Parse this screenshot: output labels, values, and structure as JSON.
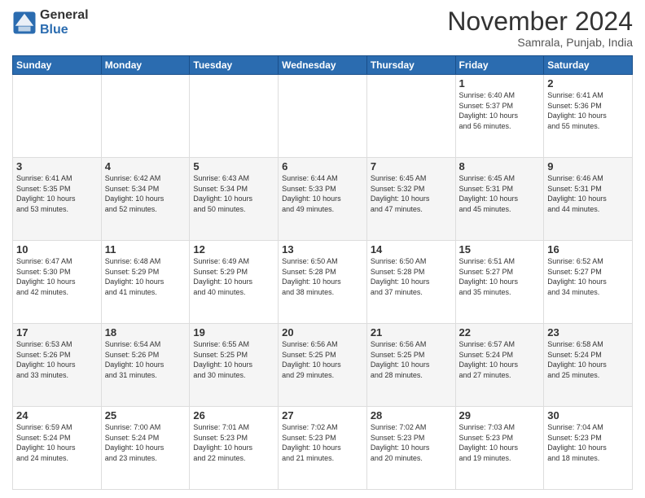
{
  "logo": {
    "general": "General",
    "blue": "Blue"
  },
  "title": "November 2024",
  "location": "Samrala, Punjab, India",
  "headers": [
    "Sunday",
    "Monday",
    "Tuesday",
    "Wednesday",
    "Thursday",
    "Friday",
    "Saturday"
  ],
  "weeks": [
    [
      {
        "day": "",
        "info": ""
      },
      {
        "day": "",
        "info": ""
      },
      {
        "day": "",
        "info": ""
      },
      {
        "day": "",
        "info": ""
      },
      {
        "day": "",
        "info": ""
      },
      {
        "day": "1",
        "info": "Sunrise: 6:40 AM\nSunset: 5:37 PM\nDaylight: 10 hours\nand 56 minutes."
      },
      {
        "day": "2",
        "info": "Sunrise: 6:41 AM\nSunset: 5:36 PM\nDaylight: 10 hours\nand 55 minutes."
      }
    ],
    [
      {
        "day": "3",
        "info": "Sunrise: 6:41 AM\nSunset: 5:35 PM\nDaylight: 10 hours\nand 53 minutes."
      },
      {
        "day": "4",
        "info": "Sunrise: 6:42 AM\nSunset: 5:34 PM\nDaylight: 10 hours\nand 52 minutes."
      },
      {
        "day": "5",
        "info": "Sunrise: 6:43 AM\nSunset: 5:34 PM\nDaylight: 10 hours\nand 50 minutes."
      },
      {
        "day": "6",
        "info": "Sunrise: 6:44 AM\nSunset: 5:33 PM\nDaylight: 10 hours\nand 49 minutes."
      },
      {
        "day": "7",
        "info": "Sunrise: 6:45 AM\nSunset: 5:32 PM\nDaylight: 10 hours\nand 47 minutes."
      },
      {
        "day": "8",
        "info": "Sunrise: 6:45 AM\nSunset: 5:31 PM\nDaylight: 10 hours\nand 45 minutes."
      },
      {
        "day": "9",
        "info": "Sunrise: 6:46 AM\nSunset: 5:31 PM\nDaylight: 10 hours\nand 44 minutes."
      }
    ],
    [
      {
        "day": "10",
        "info": "Sunrise: 6:47 AM\nSunset: 5:30 PM\nDaylight: 10 hours\nand 42 minutes."
      },
      {
        "day": "11",
        "info": "Sunrise: 6:48 AM\nSunset: 5:29 PM\nDaylight: 10 hours\nand 41 minutes."
      },
      {
        "day": "12",
        "info": "Sunrise: 6:49 AM\nSunset: 5:29 PM\nDaylight: 10 hours\nand 40 minutes."
      },
      {
        "day": "13",
        "info": "Sunrise: 6:50 AM\nSunset: 5:28 PM\nDaylight: 10 hours\nand 38 minutes."
      },
      {
        "day": "14",
        "info": "Sunrise: 6:50 AM\nSunset: 5:28 PM\nDaylight: 10 hours\nand 37 minutes."
      },
      {
        "day": "15",
        "info": "Sunrise: 6:51 AM\nSunset: 5:27 PM\nDaylight: 10 hours\nand 35 minutes."
      },
      {
        "day": "16",
        "info": "Sunrise: 6:52 AM\nSunset: 5:27 PM\nDaylight: 10 hours\nand 34 minutes."
      }
    ],
    [
      {
        "day": "17",
        "info": "Sunrise: 6:53 AM\nSunset: 5:26 PM\nDaylight: 10 hours\nand 33 minutes."
      },
      {
        "day": "18",
        "info": "Sunrise: 6:54 AM\nSunset: 5:26 PM\nDaylight: 10 hours\nand 31 minutes."
      },
      {
        "day": "19",
        "info": "Sunrise: 6:55 AM\nSunset: 5:25 PM\nDaylight: 10 hours\nand 30 minutes."
      },
      {
        "day": "20",
        "info": "Sunrise: 6:56 AM\nSunset: 5:25 PM\nDaylight: 10 hours\nand 29 minutes."
      },
      {
        "day": "21",
        "info": "Sunrise: 6:56 AM\nSunset: 5:25 PM\nDaylight: 10 hours\nand 28 minutes."
      },
      {
        "day": "22",
        "info": "Sunrise: 6:57 AM\nSunset: 5:24 PM\nDaylight: 10 hours\nand 27 minutes."
      },
      {
        "day": "23",
        "info": "Sunrise: 6:58 AM\nSunset: 5:24 PM\nDaylight: 10 hours\nand 25 minutes."
      }
    ],
    [
      {
        "day": "24",
        "info": "Sunrise: 6:59 AM\nSunset: 5:24 PM\nDaylight: 10 hours\nand 24 minutes."
      },
      {
        "day": "25",
        "info": "Sunrise: 7:00 AM\nSunset: 5:24 PM\nDaylight: 10 hours\nand 23 minutes."
      },
      {
        "day": "26",
        "info": "Sunrise: 7:01 AM\nSunset: 5:23 PM\nDaylight: 10 hours\nand 22 minutes."
      },
      {
        "day": "27",
        "info": "Sunrise: 7:02 AM\nSunset: 5:23 PM\nDaylight: 10 hours\nand 21 minutes."
      },
      {
        "day": "28",
        "info": "Sunrise: 7:02 AM\nSunset: 5:23 PM\nDaylight: 10 hours\nand 20 minutes."
      },
      {
        "day": "29",
        "info": "Sunrise: 7:03 AM\nSunset: 5:23 PM\nDaylight: 10 hours\nand 19 minutes."
      },
      {
        "day": "30",
        "info": "Sunrise: 7:04 AM\nSunset: 5:23 PM\nDaylight: 10 hours\nand 18 minutes."
      }
    ]
  ]
}
